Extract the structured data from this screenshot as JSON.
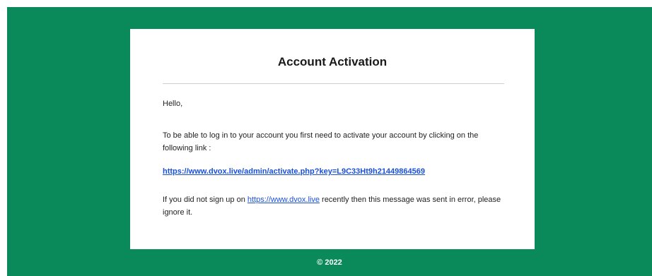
{
  "email": {
    "title": "Account Activation",
    "greeting": "Hello,",
    "instructions": "To be able to log in to your account you first need to activate your account by clicking on the following link :",
    "activation_link": "https://www.dvox.live/admin/activate.php?key=L9C33Ht9h21449864569",
    "note_before_link": "If you did not sign up on ",
    "site_link": "https://www.dvox.live",
    "note_after_link": " recently then this message was sent in error, please ignore it."
  },
  "footer": {
    "copyright": "© 2022"
  },
  "colors": {
    "background": "#0a8a5a",
    "card": "#ffffff",
    "link": "#1a4fd8"
  }
}
